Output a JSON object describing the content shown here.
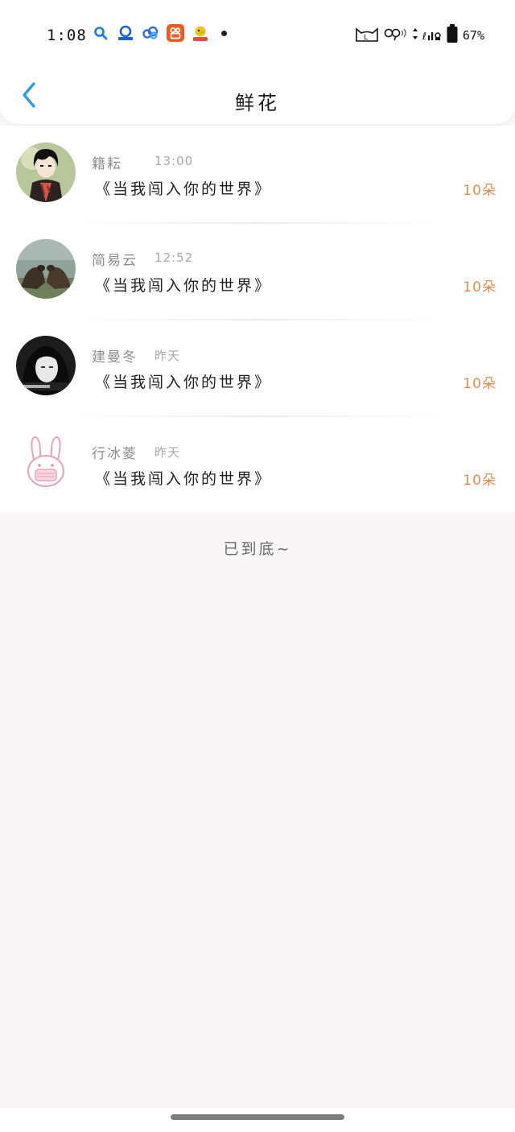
{
  "status_bar": {
    "time": "1:08",
    "battery_text": "67%",
    "app_icons": [
      "search-app-icon",
      "baidu-netdisk-icon",
      "cloud-app-icon",
      "kuaishou-icon",
      "duck-game-icon"
    ],
    "right_icons": [
      "cat-icon",
      "link-icon",
      "wifi-icon",
      "data-arrows-icon",
      "signal-icon",
      "battery-icon"
    ]
  },
  "header": {
    "title": "鲜花",
    "back_icon": "chevron-left-icon",
    "accent_color": "#2f9be4"
  },
  "items": [
    {
      "name": "籍耘",
      "time": "13:00",
      "title": "《当我闯入你的世界》",
      "count": "10朵",
      "avatar": "anime-boy-avatar"
    },
    {
      "name": "简易云",
      "time": "12:52",
      "title": "《当我闯入你的世界》",
      "count": "10朵",
      "avatar": "sea-lions-avatar"
    },
    {
      "name": "建曼冬",
      "time": "昨天",
      "title": "《当我闯入你的世界》",
      "count": "10朵",
      "avatar": "girl-portrait-avatar"
    },
    {
      "name": "行冰菱",
      "time": "昨天",
      "title": "《当我闯入你的世界》",
      "count": "10朵",
      "avatar": "pink-rabbit-avatar"
    }
  ],
  "footer": {
    "end_text": "已到底~"
  },
  "colors": {
    "count": "#e48a4c",
    "name": "#8c8c8c",
    "background": "#f8f6f7"
  }
}
